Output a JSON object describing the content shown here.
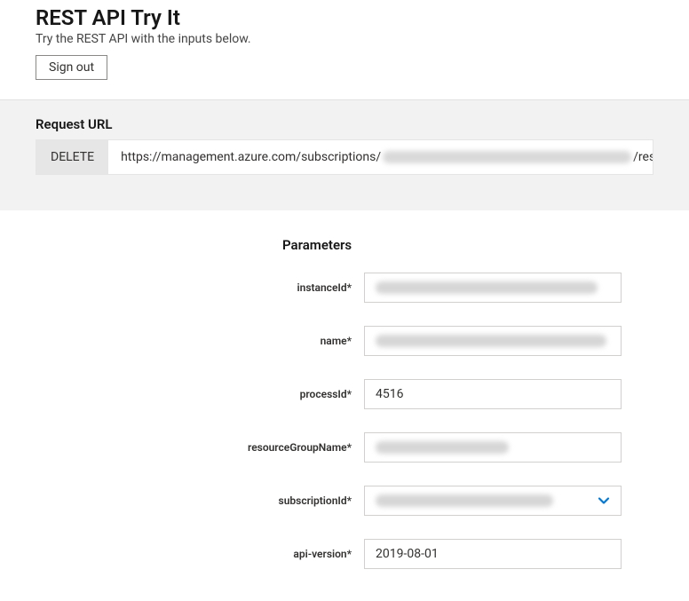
{
  "header": {
    "title": "REST API Try It",
    "subtitle": "Try the REST API with the inputs below.",
    "signout_label": "Sign out"
  },
  "request": {
    "heading": "Request URL",
    "method": "DELETE",
    "url_prefix": "https://management.azure.com/subscriptions/",
    "url_suffix": "/resourceG"
  },
  "parameters": {
    "heading": "Parameters",
    "rows": [
      {
        "label": "instanceId*",
        "value": "",
        "redacted": true,
        "type": "text",
        "blur_width": 250
      },
      {
        "label": "name*",
        "value": "",
        "redacted": true,
        "type": "text",
        "blur_width": 260
      },
      {
        "label": "processId*",
        "value": "4516",
        "redacted": false,
        "type": "text"
      },
      {
        "label": "resourceGroupName*",
        "value": "",
        "redacted": true,
        "type": "text",
        "blur_width": 150
      },
      {
        "label": "subscriptionId*",
        "value": "",
        "redacted": true,
        "type": "select",
        "blur_width": 200
      },
      {
        "label": "api-version*",
        "value": "2019-08-01",
        "redacted": false,
        "type": "text"
      }
    ]
  }
}
